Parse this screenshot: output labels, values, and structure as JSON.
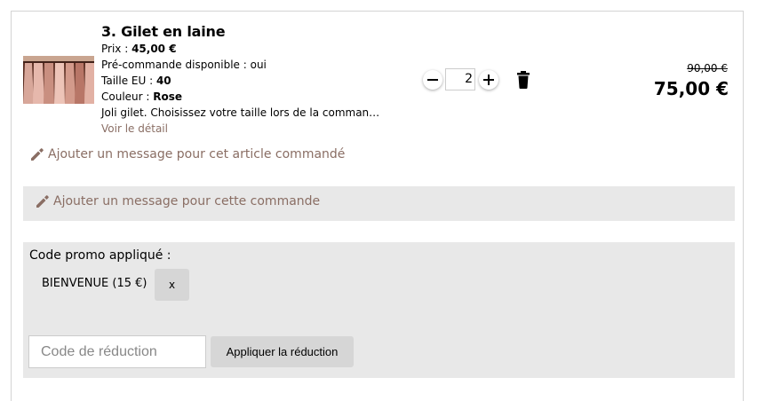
{
  "item": {
    "title": "3. Gilet en laine",
    "price_label": "Prix : ",
    "price_value": "45,00 €",
    "preorder": "Pré-commande disponible : oui",
    "size_label": "Taille EU : ",
    "size_value": "40",
    "color_label": "Couleur : ",
    "color_value": "Rose",
    "description": "Joli gilet. Choisissez votre taille lors de la comman…",
    "detail_link": "Voir le détail",
    "quantity": "2",
    "old_price": "90,00 €",
    "total_price": "75,00 €",
    "item_message_link": "Ajouter un message pour cet article commandé",
    "thumbnail_icon": "clothing-rack-photo"
  },
  "order": {
    "message_link": "Ajouter un message pour cette commande"
  },
  "promo": {
    "applied_label": "Code promo appliqué :",
    "applied_code": "BIENVENUE (15 €)",
    "remove_label": "x",
    "input_placeholder": "Code de réduction",
    "apply_label": "Appliquer la réduction"
  },
  "colors": {
    "link": "#8a6e64",
    "panel_bg": "#e8e8e8",
    "button_bg": "#d6d6d6"
  }
}
